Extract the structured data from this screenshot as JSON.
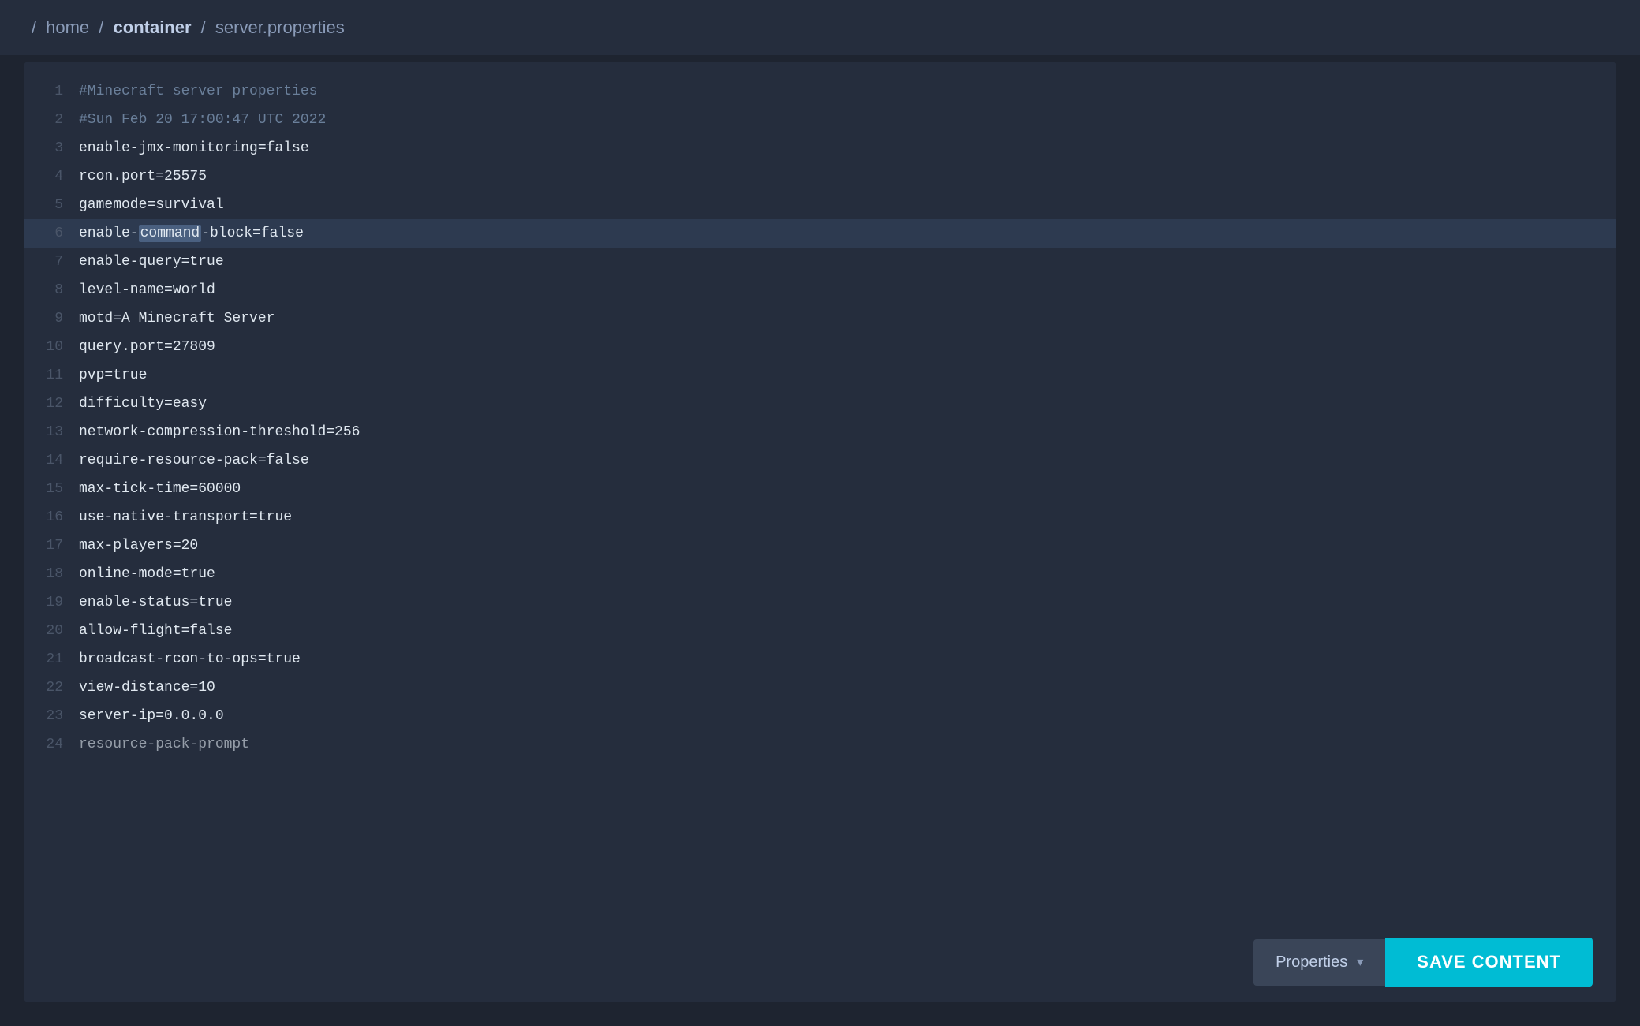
{
  "breadcrumb": {
    "slash1": "/",
    "home": "home",
    "slash2": "/",
    "container": "container",
    "slash3": "/",
    "file": "server.properties"
  },
  "editor": {
    "lines": [
      {
        "num": 1,
        "text": "#Minecraft server properties",
        "type": "comment"
      },
      {
        "num": 2,
        "text": "#Sun Feb 20 17:00:47 UTC 2022",
        "type": "comment"
      },
      {
        "num": 3,
        "text": "enable-jmx-monitoring=false",
        "type": "code"
      },
      {
        "num": 4,
        "text": "rcon.port=25575",
        "type": "code"
      },
      {
        "num": 5,
        "text": "gamemode=survival",
        "type": "code"
      },
      {
        "num": 6,
        "text": "enable-command-block=false",
        "type": "code-highlight",
        "highlight": "command"
      },
      {
        "num": 7,
        "text": "enable-query=true",
        "type": "code"
      },
      {
        "num": 8,
        "text": "level-name=world",
        "type": "code"
      },
      {
        "num": 9,
        "text": "motd=A Minecraft Server",
        "type": "code"
      },
      {
        "num": 10,
        "text": "query.port=27809",
        "type": "code"
      },
      {
        "num": 11,
        "text": "pvp=true",
        "type": "code"
      },
      {
        "num": 12,
        "text": "difficulty=easy",
        "type": "code"
      },
      {
        "num": 13,
        "text": "network-compression-threshold=256",
        "type": "code"
      },
      {
        "num": 14,
        "text": "require-resource-pack=false",
        "type": "code"
      },
      {
        "num": 15,
        "text": "max-tick-time=60000",
        "type": "code"
      },
      {
        "num": 16,
        "text": "use-native-transport=true",
        "type": "code"
      },
      {
        "num": 17,
        "text": "max-players=20",
        "type": "code"
      },
      {
        "num": 18,
        "text": "online-mode=true",
        "type": "code"
      },
      {
        "num": 19,
        "text": "enable-status=true",
        "type": "code"
      },
      {
        "num": 20,
        "text": "allow-flight=false",
        "type": "code"
      },
      {
        "num": 21,
        "text": "broadcast-rcon-to-ops=true",
        "type": "code"
      },
      {
        "num": 22,
        "text": "view-distance=10",
        "type": "code"
      },
      {
        "num": 23,
        "text": "server-ip=0.0.0.0",
        "type": "code"
      },
      {
        "num": 24,
        "text": "resource-pack-prompt",
        "type": "code-partial"
      }
    ]
  },
  "bottom_bar": {
    "properties_label": "Properties",
    "save_label": "SAVE CONTENT"
  }
}
